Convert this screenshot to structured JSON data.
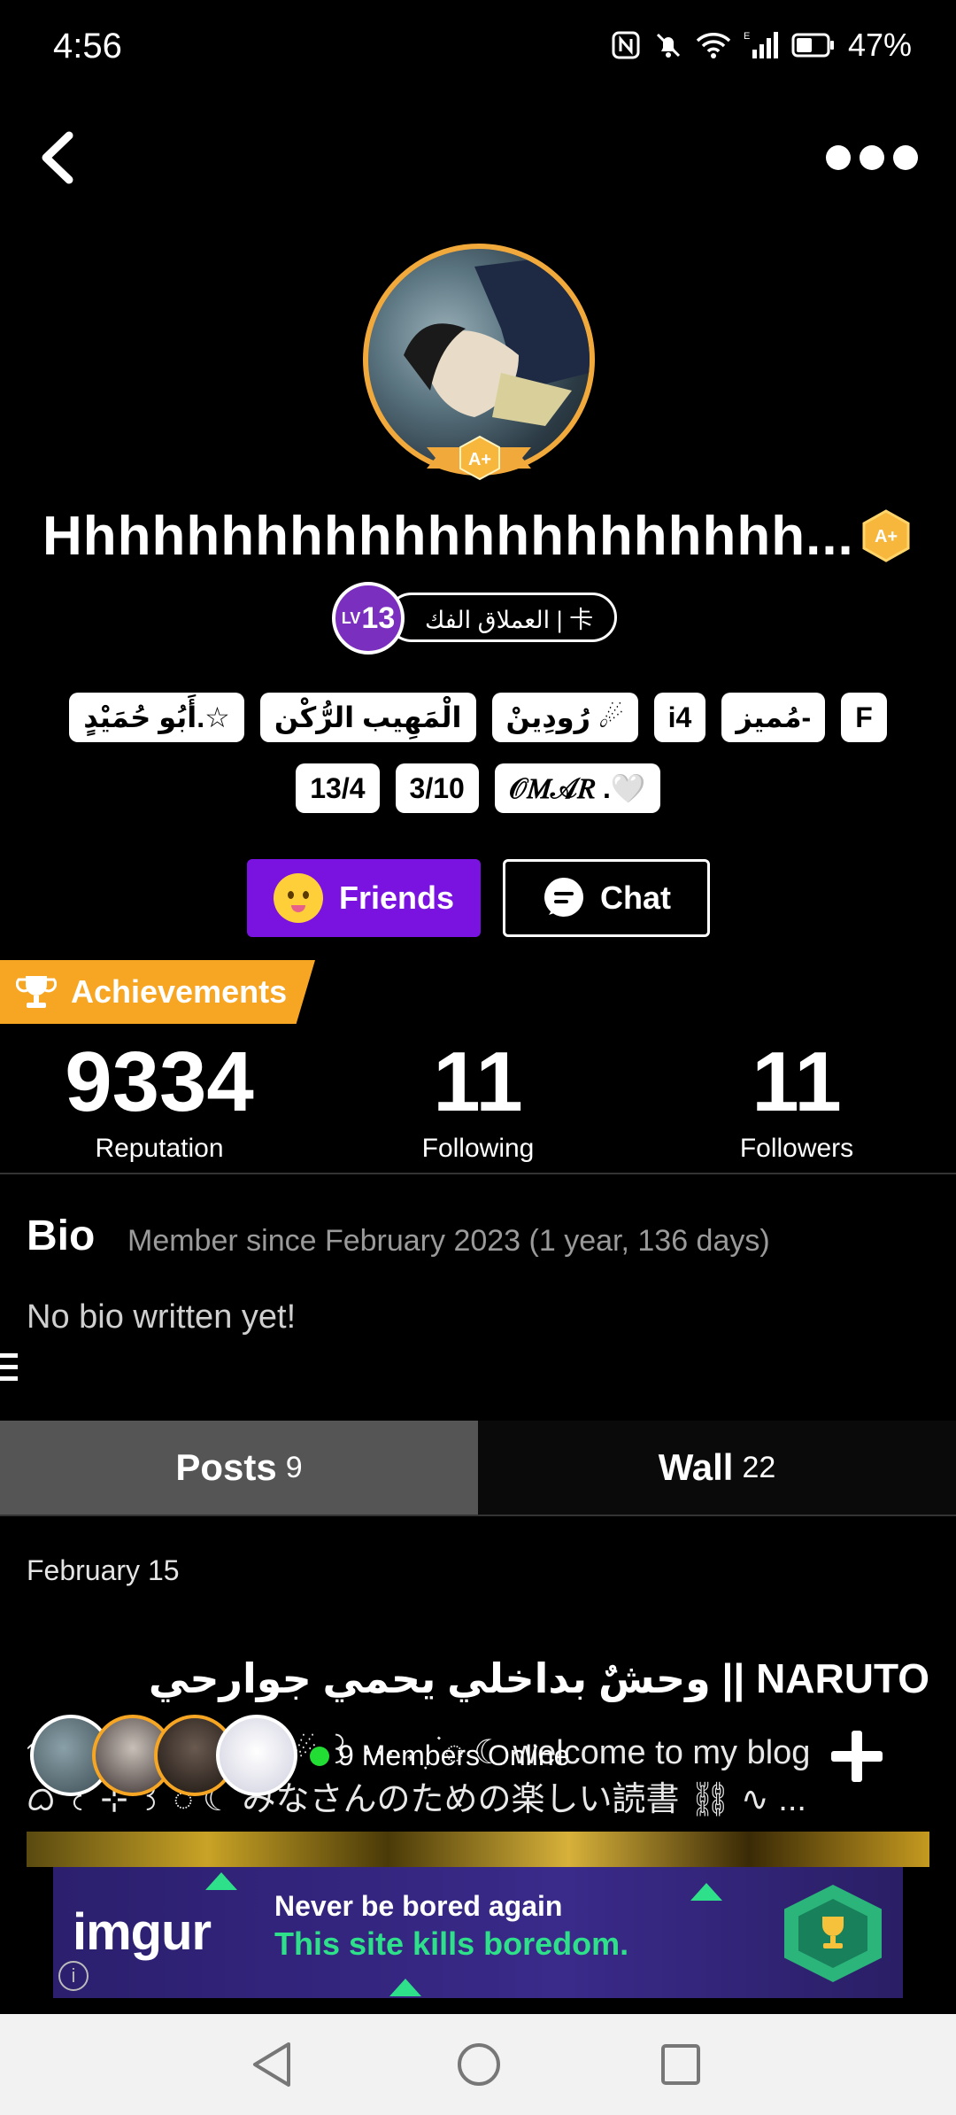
{
  "status_bar": {
    "time": "4:56",
    "network": "E",
    "battery": "47%"
  },
  "profile": {
    "username": "Hhhhhhhhhhhhhhhhhhhhhh...",
    "level_prefix": "LV",
    "level": "13",
    "title": "العملاق الفك | 卡",
    "tags_row1": [
      "أَبُو حُمَيْدٍ.☆",
      "الْمَهِيب الرُّكْن",
      "رُودِينْ ☄",
      "i4",
      "مُميز-",
      "F"
    ],
    "tags_row2": [
      "13/4",
      "3/10",
      "𝒪𝑀𝒜𝑅 .🤍"
    ],
    "accent_color": "#7a12e0",
    "frame_color": "#f2a93b"
  },
  "actions": {
    "friends_label": "Friends",
    "chat_label": "Chat"
  },
  "achievements": {
    "label": "Achievements",
    "color": "#f6a623"
  },
  "stats": [
    {
      "value": "9334",
      "label": "Reputation"
    },
    {
      "value": "11",
      "label": "Following"
    },
    {
      "value": "11",
      "label": "Followers"
    }
  ],
  "bio": {
    "title": "Bio",
    "member_since": "Member since February 2023 (1 year, 136 days)",
    "text": "No bio written yet!"
  },
  "tabs": [
    {
      "label": "Posts",
      "count": "9"
    },
    {
      "label": "Wall",
      "count": "22"
    }
  ],
  "feed": {
    "date": "February 15",
    "post_title": "وحشٌ بداخلي يحمي جوارحي || NARUTO",
    "post_line1": "࿐ ⋮ ⊹ ꒰ hello ☄ ꒱ ⋯ ˖ ִ ࣪ ◌ ☾ welcome to my blog",
    "post_line2": "ᜊ ꒰ ⊹ ꒱ ◌ ☾ みなさんのための楽しい読書 ⛓ ∿ ..."
  },
  "online": {
    "text": "9 Members Online",
    "dot_color": "#22dd33"
  },
  "ad": {
    "brand": "imgur",
    "line1": "Never be bored again",
    "line2": "This site kills boredom.",
    "info": "i"
  },
  "icons": [
    "back-arrow-icon",
    "more-dots-icon",
    "trophy-icon",
    "chat-bubble-icon",
    "plus-icon",
    "nav-back-icon",
    "nav-home-icon",
    "nav-recents-icon"
  ]
}
